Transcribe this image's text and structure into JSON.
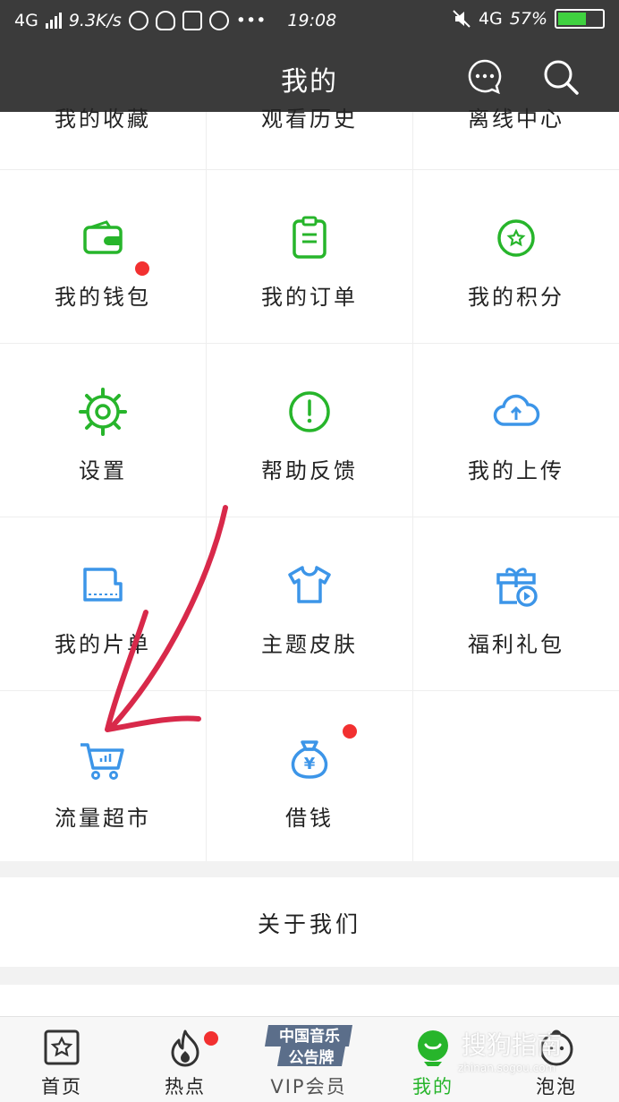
{
  "status_bar": {
    "network_left": "4G",
    "speed": "9.3K/s",
    "more": "•••",
    "time": "19:08",
    "network_right": "4G",
    "battery": "57%"
  },
  "header": {
    "title": "我的",
    "message_icon": "chat-bubble-icon",
    "search_icon": "search-icon"
  },
  "grid": {
    "top_row": [
      "我的收藏",
      "观看历史",
      "离线中心"
    ],
    "rows": [
      [
        {
          "label": "我的钱包",
          "icon": "wallet-icon",
          "color": "#27b52b",
          "badge": true
        },
        {
          "label": "我的订单",
          "icon": "clipboard-icon",
          "color": "#27b52b",
          "badge": false
        },
        {
          "label": "我的积分",
          "icon": "star-coin-icon",
          "color": "#27b52b",
          "badge": false
        }
      ],
      [
        {
          "label": "设置",
          "icon": "gear-icon",
          "color": "#27b52b",
          "badge": false
        },
        {
          "label": "帮助反馈",
          "icon": "exclamation-circle-icon",
          "color": "#27b52b",
          "badge": false
        },
        {
          "label": "我的上传",
          "icon": "cloud-upload-icon",
          "color": "#3c95e8",
          "badge": false
        }
      ],
      [
        {
          "label": "我的片单",
          "icon": "film-list-icon",
          "color": "#3c95e8",
          "badge": false
        },
        {
          "label": "主题皮肤",
          "icon": "tshirt-icon",
          "color": "#3c95e8",
          "badge": false
        },
        {
          "label": "福利礼包",
          "icon": "gift-play-icon",
          "color": "#3c95e8",
          "badge": false
        }
      ],
      [
        {
          "label": "流量超市",
          "icon": "shopping-cart-icon",
          "color": "#3c95e8",
          "badge": false
        },
        {
          "label": "借钱",
          "icon": "money-bag-icon",
          "color": "#3c95e8",
          "badge": true
        }
      ]
    ]
  },
  "about": {
    "label": "关于我们"
  },
  "tab_bar": {
    "tabs": [
      {
        "label": "首页",
        "icon": "home-star-icon",
        "active": false,
        "badge": false
      },
      {
        "label": "热点",
        "icon": "flame-icon",
        "active": false,
        "badge": true
      },
      {
        "label": "VIP会员",
        "icon": "vip-logo-icon",
        "active": false,
        "badge": false
      },
      {
        "label": "我的",
        "icon": "profile-icon",
        "active": true,
        "badge": false
      },
      {
        "label": "泡泡",
        "icon": "bubble-face-icon",
        "active": false,
        "badge": false
      }
    ],
    "vip_logo_lines": [
      "中国音乐",
      "公告牌"
    ]
  },
  "colors": {
    "header_bg": "#3b3b3b",
    "green": "#27b52b",
    "blue": "#3c95e8",
    "badge_red": "#f23030",
    "annotation_arrow": "#d8294a"
  },
  "watermark": {
    "text": "搜狗指南",
    "sub": "zhinan.sogou.com"
  }
}
